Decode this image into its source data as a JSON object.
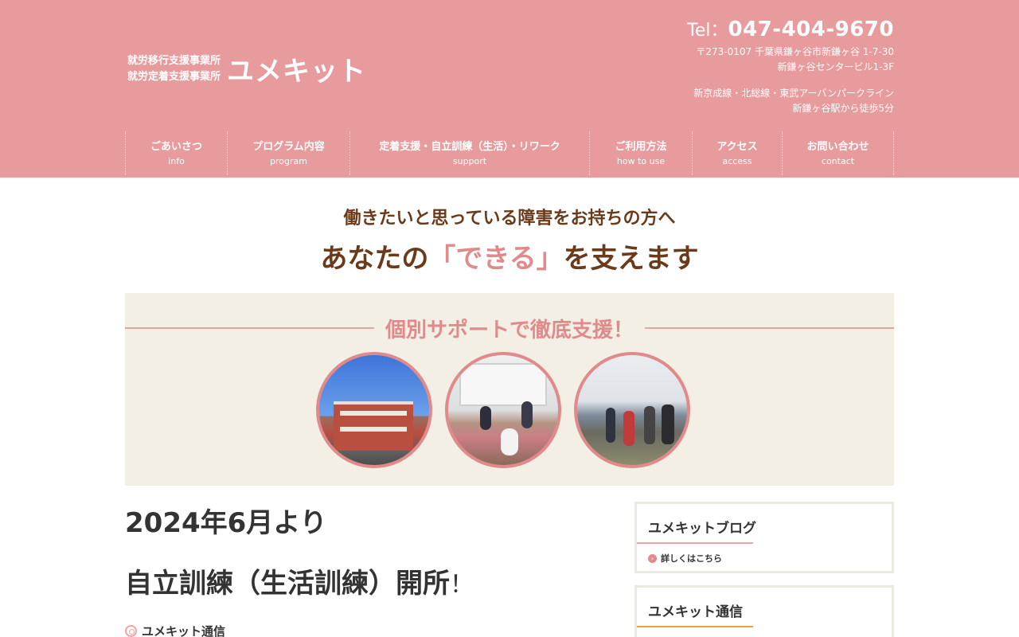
{
  "header": {
    "brand_sub_1": "就労移行支援事業所",
    "brand_sub_2": "就労定着支援事業所",
    "brand_title": "ユメキット",
    "tel_label": "Tel：",
    "tel_number": "047-404-9670",
    "address_1": "〒273-0107 千葉県鎌ヶ谷市新鎌ヶ谷 1-7-30",
    "address_2": "新鎌ヶ谷センタービル1-3F",
    "access_1": "新京成線・北総線・東武アーバンパークライン",
    "access_2": "新鎌ヶ谷駅から徒歩5分"
  },
  "nav": [
    {
      "jp": "ごあいさつ",
      "en": "info"
    },
    {
      "jp": "プログラム内容",
      "en": "program"
    },
    {
      "jp": "定着支援・自立訓練（生活）・リワーク",
      "en": "support"
    },
    {
      "jp": "ご利用方法",
      "en": "how to use"
    },
    {
      "jp": "アクセス",
      "en": "access"
    },
    {
      "jp": "お問い合わせ",
      "en": "contact"
    }
  ],
  "tagline": {
    "line1": "働きたいと思っている障害をお持ちの方へ",
    "line2_before": "あなたの",
    "line2_highlight": "「できる」",
    "line2_after": "を支えます"
  },
  "banner": {
    "title": "個別サポートで徹底支援！",
    "images": [
      "building-photo",
      "yoga-class-photo",
      "group-walk-photo"
    ]
  },
  "main": {
    "heading_date": "2024年6月より",
    "heading_open": "自立訓練（生活訓練）開所",
    "heading_open_mark": "！",
    "category": "ユメキット通信"
  },
  "sidebar": {
    "blog_title": "ユメキットブログ",
    "blog_link": "詳しくはこちら",
    "news_title": "ユメキット通信"
  },
  "colors": {
    "header_bg": "#e89b9c",
    "accent_pink": "#e18a8b",
    "tagline_brown": "#6b3a1a",
    "banner_bg": "#f4efe4",
    "orange_underline": "#f0a23a"
  }
}
